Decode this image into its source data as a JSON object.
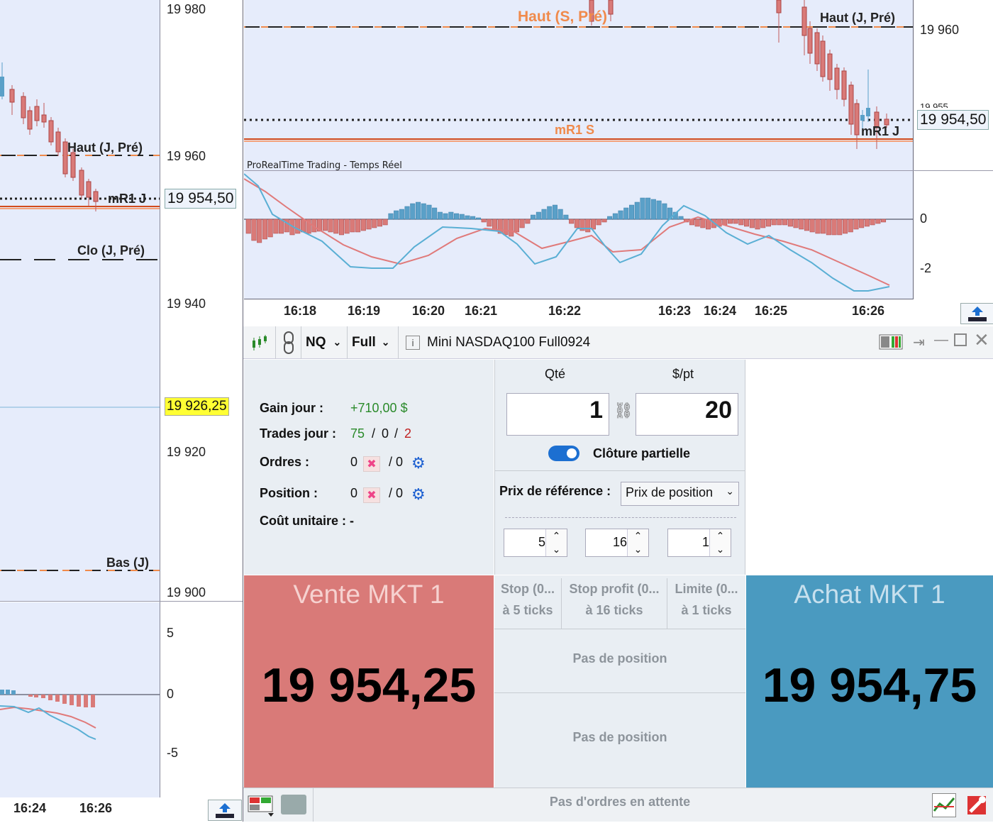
{
  "left_chart": {
    "price_ticks": [
      "19 980",
      "19 960",
      "19 940",
      "19 920",
      "19 900"
    ],
    "current_price": "19 954,50",
    "highlight_price": "19 926,25",
    "levels": {
      "haut_j_pre": "Haut (J, Pré)",
      "mr1_j": "mR1 J",
      "clo_j_pre": "Clo (J, Pré)",
      "bas_j": "Bas (J)"
    },
    "osc_ticks": [
      "5",
      "0",
      "-5"
    ],
    "time_ticks": [
      "16:24",
      "16:26"
    ]
  },
  "main_chart": {
    "price_ticks": [
      "19 960",
      "19 955"
    ],
    "current_price": "19 954,50",
    "levels": {
      "haut_s_pre": "Haut (S, Pré)",
      "haut_j_pre": "Haut (J, Pré)",
      "mr1_s": "mR1 S",
      "mr1_j": "mR1 J"
    },
    "source_label": "ProRealTime Trading - Temps Réel",
    "osc_ticks": [
      "0",
      "-2"
    ],
    "time_ticks": [
      "16:18",
      "16:19",
      "16:20",
      "16:21",
      "16:22",
      "16:23",
      "16:24",
      "16:25",
      "16:26"
    ]
  },
  "toolbar": {
    "symbol": "NQ",
    "mode": "Full",
    "instrument": "Mini NASDAQ100 Full0924"
  },
  "stats": {
    "gain_label": "Gain jour :",
    "gain_value": "+710,00 $",
    "trades_label": "Trades jour :",
    "trades_a": "75",
    "trades_b": "0",
    "trades_c": "2",
    "sep": "/",
    "ordres_label": "Ordres :",
    "ordres_a": "0",
    "ordres_b": "/ 0",
    "position_label": "Position :",
    "position_a": "0",
    "position_b": "/ 0",
    "cout_label": "Coût unitaire : -"
  },
  "order": {
    "qty_label": "Qté",
    "pt_label": "$/pt",
    "qty": "1",
    "pt": "20",
    "partial_close_label": "Clôture partielle",
    "ref_label": "Prix de référence :",
    "ref_value": "Prix de position",
    "stop": "5",
    "stop_profit": "16",
    "limit": "1",
    "stop_title": "Stop (0...",
    "stop_sub": "à 5 ticks",
    "sp_title": "Stop profit (0...",
    "sp_sub": "à 16 ticks",
    "lim_title": "Limite (0...",
    "lim_sub": "à 1 ticks",
    "no_position": "Pas de position",
    "no_orders": "Pas d'ordres en attente"
  },
  "sell": {
    "label": "Vente MKT 1",
    "price": "19 954,25",
    "color": "#d97a78"
  },
  "buy": {
    "label": "Achat MKT 1",
    "price": "19 954,75",
    "color": "#4a9ac0"
  }
}
